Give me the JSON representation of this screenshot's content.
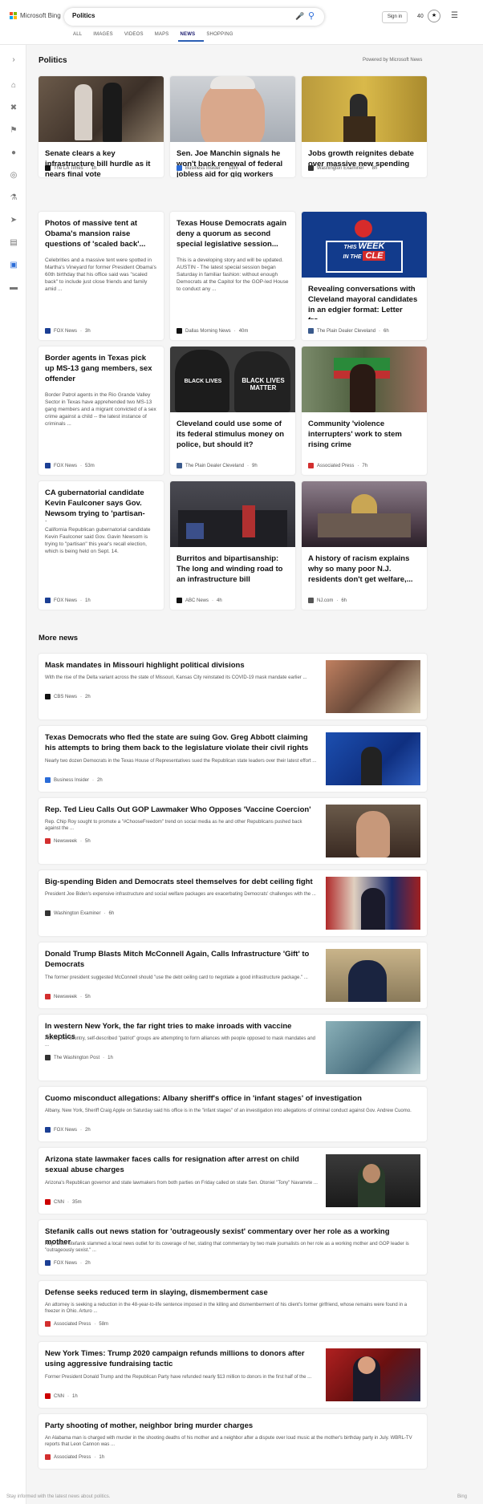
{
  "header": {
    "brand": "Microsoft Bing",
    "query": "Politics",
    "signin": "Sign in",
    "points": "40",
    "reward_icon": "trophy-icon",
    "colors": {
      "ms_red": "#f25022",
      "ms_green": "#7fba00",
      "ms_blue": "#00a4ef",
      "ms_yellow": "#ffb900",
      "accent": "#2b6cd8"
    }
  },
  "nav": {
    "tabs": [
      "ALL",
      "IMAGES",
      "VIDEOS",
      "MAPS",
      "NEWS",
      "SHOPPING"
    ],
    "active": "NEWS"
  },
  "section": {
    "title": "Politics",
    "powered": "Powered by Microsoft News"
  },
  "cards": [
    {
      "title": "Senate clears a key infrastructure bill hurdle as it nears final vote",
      "desc": "",
      "source": "The LA Times",
      "time": "1h",
      "logo": "#111111"
    },
    {
      "title": "Sen. Joe Manchin signals he won't back renewal of federal jobless aid for gig workers an...",
      "desc": "",
      "source": "Business Insider",
      "time": "18m",
      "logo": "#2b6cd8"
    },
    {
      "title": "Jobs growth reignites debate over massive new spending",
      "desc": "",
      "source": "Washington Examiner",
      "time": "8h",
      "logo": "#333333"
    },
    {
      "title": "Photos of massive tent at Obama's mansion raise questions of 'scaled back'...",
      "desc": "Celebrities and a massive tent were spotted in Martha's Vineyard for former President Obama's 60th birthday that his office said was \"scaled back\" to include just close friends and family amid ...",
      "source": "FOX News",
      "time": "3h",
      "logo": "#1c3f94"
    },
    {
      "title": "Texas House Democrats again deny a quorum as second special legislative session...",
      "desc": "This is a developing story and will be updated. AUSTIN - The latest special session began Saturday in familiar fashion: without enough Democrats at the Capitol for the GOP-led House to conduct any ...",
      "source": "Dallas Morning News",
      "time": "40m",
      "logo": "#111111"
    },
    {
      "title": "Revealing conversations with Cleveland mayoral candidates in an edgier format: Letter fro...",
      "desc": "",
      "source": "The Plain Dealer Cleveland",
      "time": "6h",
      "logo": "#3a5a8c"
    },
    {
      "title": "Border agents in Texas pick up MS-13 gang members, sex offender",
      "desc": "Border Patrol agents in the Rio Grande Valley Sector in Texas have apprehended two MS-13 gang members and a migrant convicted of a sex crime against a child -- the latest instance of criminals ...",
      "source": "FOX News",
      "time": "53m",
      "logo": "#1c3f94"
    },
    {
      "title": "Cleveland could use some of its federal stimulus money on police, but should it?",
      "desc": "",
      "source": "The Plain Dealer Cleveland",
      "time": "9h",
      "logo": "#3a5a8c"
    },
    {
      "title": "Community 'violence interrupters' work to stem rising crime",
      "desc": "",
      "source": "Associated Press",
      "time": "7h",
      "logo": "#d32f2f"
    },
    {
      "title": "CA gubernatorial candidate Kevin Faulconer says Gov. Newsom trying to 'partisan-iz...",
      "desc": "California Republican gubernatorial candidate Kevin Faulconer said Gov. Gavin Newsom is trying to \"partisan\" this year's recall election, which is being held on Sept. 14.",
      "source": "FOX News",
      "time": "1h",
      "logo": "#1c3f94"
    },
    {
      "title": "Burritos and bipartisanship: The long and winding road to an infrastructure bill",
      "desc": "",
      "source": "ABC News",
      "time": "4h",
      "logo": "#111111"
    },
    {
      "title": "A history of racism explains why so many poor N.J. residents don't get welfare,...",
      "desc": "",
      "source": "NJ.com",
      "time": "6h",
      "logo": "#555555"
    }
  ],
  "badge": {
    "line1": "THIS",
    "line2": "WEEK",
    "line3": "IN THE",
    "line4": "CLE"
  },
  "signs": {
    "a": "BLACK LIVES",
    "b": "BLACK LIVES MATTER"
  },
  "more": {
    "title": "More news"
  },
  "rows": [
    {
      "title": "Mask mandates in Missouri highlight political divisions",
      "desc": "With the rise of the Delta variant across the state of Missouri, Kansas City reinstated its COVID-19 mask mandate earlier ...",
      "source": "CBS News",
      "time": "2h",
      "logo": "#111111"
    },
    {
      "title": "Texas Democrats who fled the state are suing Gov. Greg Abbott claiming his attempts to bring them back to the legislature violate their civil rights",
      "desc": "Nearly two dozen Democrats in the Texas House of Representatives sued the Republican state leaders over their latest effort ...",
      "source": "Business Insider",
      "time": "2h",
      "logo": "#2b6cd8"
    },
    {
      "title": "Rep. Ted Lieu Calls Out GOP Lawmaker Who Opposes 'Vaccine Coercion'",
      "desc": "Rep. Chip Roy sought to promote a \"#ChooseFreedom\" trend on social media as he and other Republicans pushed back against the ...",
      "source": "Newsweek",
      "time": "5h",
      "logo": "#d32f2f"
    },
    {
      "title": "Big-spending Biden and Democrats steel themselves for debt ceiling fight",
      "desc": "President Joe Biden's expensive infrastructure and social welfare packages are exacerbating Democrats' challenges with the ...",
      "source": "Washington Examiner",
      "time": "6h",
      "logo": "#333333"
    },
    {
      "title": "Donald Trump Blasts Mitch McConnell Again, Calls Infrastructure 'Gift' to Democrats",
      "desc": "The former president suggested McConnell should \"use the debt ceiling card to negotiate a good infrastructure package.\" ...",
      "source": "Newsweek",
      "time": "5h",
      "logo": "#d32f2f"
    },
    {
      "title": "In western New York, the far right tries to make inroads with vaccine skeptics",
      "desc": "Across the country, self-described \"patriot\" groups are attempting to form alliances with people opposed to mask mandates and ...",
      "source": "The Washington Post",
      "time": "1h",
      "logo": "#333333"
    },
    {
      "title": "Cuomo misconduct allegations: Albany sheriff's office in 'infant stages' of investigation",
      "desc": "Albany, New York, Sheriff Craig Apple on Saturday said his office is in the \"infant stages\" of an investigation into allegations of criminal conduct against Gov. Andrew Cuomo.",
      "source": "FOX News",
      "time": "2h",
      "logo": "#1c3f94"
    },
    {
      "title": "Arizona state lawmaker faces calls for resignation after arrest on child sexual abuse charges",
      "desc": "Arizona's Republican governor and state lawmakers from both parties on Friday called on state Sen. Otoniel \"Tony\" Navarrete ...",
      "source": "CNN",
      "time": "35m",
      "logo": "#cc0000"
    },
    {
      "title": "Stefanik calls out news station for 'outrageously sexist' commentary over her role as a working mother",
      "desc": "Rep. Elise Stefanik slammed a local news outlet for its coverage of her, stating that commentary by two male journalists on her role as a working mother and GOP leader is \"outrageously sexist.\" ...",
      "source": "FOX News",
      "time": "2h",
      "logo": "#1c3f94"
    },
    {
      "title": "Defense seeks reduced term in slaying, dismemberment case",
      "desc": "An attorney is seeking a reduction in the 48-year-to-life sentence imposed in the killing and dismemberment of his client's former girlfriend, whose remains were found in a freezer in Ohio. Arturo ...",
      "source": "Associated Press",
      "time": "58m",
      "logo": "#d32f2f"
    },
    {
      "title": "New York Times: Trump 2020 campaign refunds millions to donors after using aggressive fundraising tactic",
      "desc": "Former President Donald Trump and the Republican Party have refunded nearly $13 million to donors in the first half of the ...",
      "source": "CNN",
      "time": "1h",
      "logo": "#cc0000"
    },
    {
      "title": "Party shooting of mother, neighbor bring murder charges",
      "desc": "An Alabama man is charged with murder in the shooting deaths of his mother and a neighbor after a dispute over loud music at the mother's birthday party in July. WBRL-TV reports that Leon Cannon was ...",
      "source": "Associated Press",
      "time": "1h",
      "logo": "#d32f2f"
    }
  ],
  "footer": {
    "left": "Stay informed with the latest news about politics.",
    "right": "Bing"
  },
  "icons": [
    "chevron-right-icon",
    "home-icon",
    "tools-icon",
    "flag-icon",
    "location-icon",
    "globe-icon",
    "science-icon",
    "rocket-icon",
    "film-icon",
    "briefcase-icon",
    "card-icon"
  ]
}
